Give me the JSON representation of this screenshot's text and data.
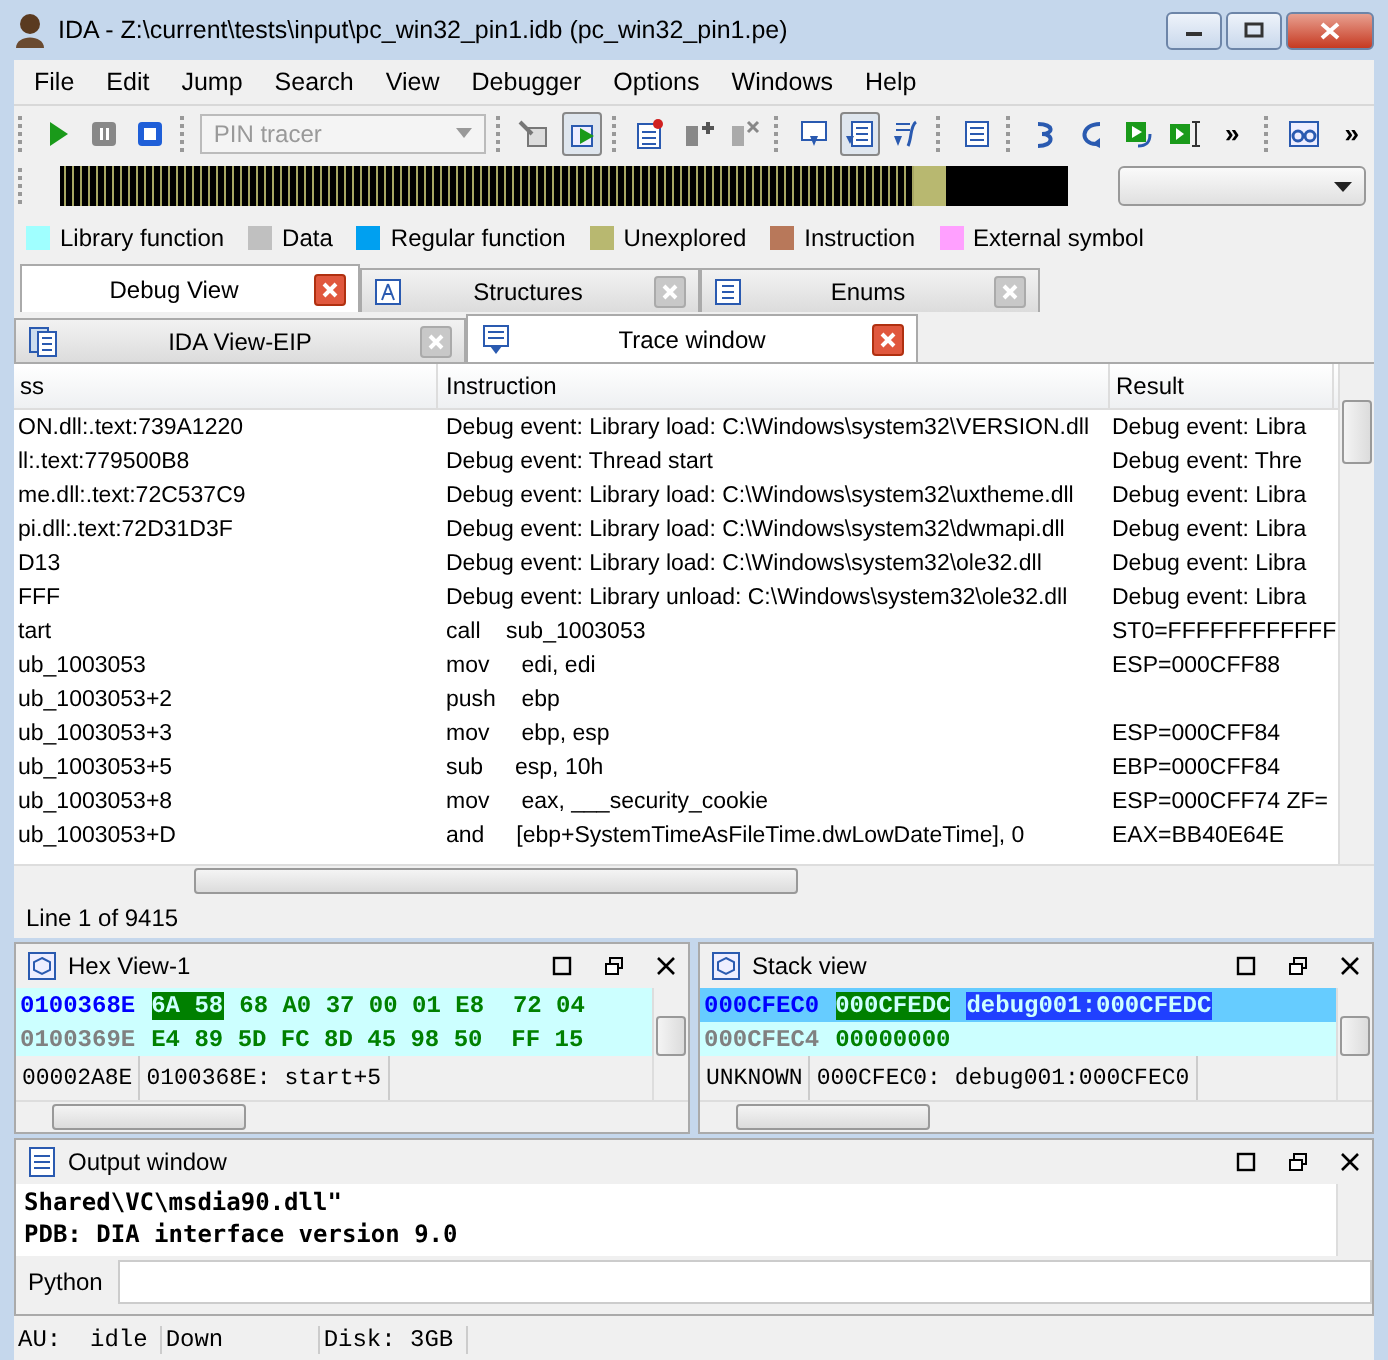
{
  "window": {
    "title": "IDA - Z:\\current\\tests\\input\\pc_win32_pin1.idb (pc_win32_pin1.pe)"
  },
  "menu": [
    "File",
    "Edit",
    "Jump",
    "Search",
    "View",
    "Debugger",
    "Options",
    "Windows",
    "Help"
  ],
  "toolbar": {
    "debugger_combo": {
      "value": "PIN tracer",
      "disabled": true
    },
    "buttons": [
      {
        "pressed": false
      },
      {
        "pressed": false
      },
      {
        "pressed": false
      },
      {
        "pressed": false
      },
      {
        "pressed": true
      },
      {
        "pressed": false
      },
      {
        "pressed": false
      },
      {
        "pressed": false
      },
      {
        "pressed": false
      },
      {
        "pressed": true
      },
      {
        "pressed": false
      },
      {
        "pressed": false
      },
      {
        "pressed": false
      },
      {
        "pressed": false
      },
      {
        "pressed": false
      },
      {
        "pressed": false
      },
      {
        "pressed": false
      }
    ],
    "overflow": [
      "»",
      "»"
    ]
  },
  "legend": [
    {
      "label": "Library function",
      "color": "#a0ffff"
    },
    {
      "label": "Data",
      "color": "#c0c0c0"
    },
    {
      "label": "Regular function",
      "color": "#00a0f0"
    },
    {
      "label": "Unexplored",
      "color": "#b8b870"
    },
    {
      "label": "Instruction",
      "color": "#b8785a"
    },
    {
      "label": "External symbol",
      "color": "#ffa0ff"
    }
  ],
  "tabs_top": [
    {
      "label": "Debug View",
      "selected": true
    },
    {
      "label": "Structures",
      "selected": false
    },
    {
      "label": "Enums",
      "selected": false
    }
  ],
  "tabs_bottom": [
    {
      "label": "IDA View-EIP",
      "selected": false
    },
    {
      "label": "Trace window",
      "selected": true
    }
  ],
  "table": {
    "columns": [
      "ss",
      "Instruction",
      "Result"
    ],
    "rows": [
      {
        "address": "ON.dll:.text:739A1220",
        "instruction": "Debug event: Library load: C:\\Windows\\system32\\VERSION.dll",
        "result": "Debug event: Libra"
      },
      {
        "address": "ll:.text:779500B8",
        "instruction": "Debug event: Thread start",
        "result": "Debug event: Thre"
      },
      {
        "address": "me.dll:.text:72C537C9",
        "instruction": "Debug event: Library load: C:\\Windows\\system32\\uxtheme.dll",
        "result": "Debug event: Libra"
      },
      {
        "address": "pi.dll:.text:72D31D3F",
        "instruction": "Debug event: Library load: C:\\Windows\\system32\\dwmapi.dll",
        "result": "Debug event: Libra"
      },
      {
        "address": "D13",
        "instruction": "Debug event: Library load: C:\\Windows\\system32\\ole32.dll",
        "result": "Debug event: Libra"
      },
      {
        "address": "FFF",
        "instruction": "Debug event: Library unload: C:\\Windows\\system32\\ole32.dll",
        "result": "Debug event: Libra"
      },
      {
        "address": "tart",
        "instruction": "call    sub_1003053",
        "result": "ST0=FFFFFFFFFFFF"
      },
      {
        "address": "ub_1003053",
        "instruction": "mov     edi, edi",
        "result": "ESP=000CFF88"
      },
      {
        "address": "ub_1003053+2",
        "instruction": "push    ebp"
      },
      {
        "address": "ub_1003053+3",
        "instruction": "mov     ebp, esp",
        "result": "ESP=000CFF84"
      },
      {
        "address": "ub_1003053+5",
        "instruction": "sub     esp, 10h",
        "result": "EBP=000CFF84"
      },
      {
        "address": "ub_1003053+8",
        "instruction": "mov     eax, ___security_cookie",
        "result": "ESP=000CFF74 ZF="
      },
      {
        "address": "ub_1003053+D",
        "instruction": "and     [ebp+SystemTimeAsFileTime.dwLowDateTime], 0",
        "result": "EAX=BB40E64E"
      }
    ]
  },
  "line_status": "Line 1 of 9415",
  "hex_view": {
    "title": "Hex View-1",
    "rows": [
      {
        "address": "0100368E",
        "selected": true,
        "marked": "6A 58",
        "bytes": "68 A0 37 00 01 E8  72 04"
      },
      {
        "address": "0100369E",
        "selected": false,
        "bytes": "E4 89 5D FC 8D 45 98 50  FF 15"
      }
    ],
    "status": [
      "00002A8E",
      "0100368E: start+5"
    ]
  },
  "stack_view": {
    "title": "Stack view",
    "rows": [
      {
        "address": "000CFEC0",
        "selected": true,
        "value": "000CFEDC",
        "comment": "debug001:000CFEDC"
      },
      {
        "address": "000CFEC4",
        "selected": false,
        "value": "00000000"
      }
    ],
    "status": [
      "UNKNOWN",
      "000CFEC0: debug001:000CFEC0"
    ]
  },
  "output_window": {
    "title": "Output window",
    "lines": [
      "Shared\\VC\\msdia90.dll\"",
      "PDB: DIA interface version 9.0"
    ],
    "input_label": "Python"
  },
  "status_bar": [
    "AU:  idle",
    "Down",
    "Disk: 3GB"
  ]
}
